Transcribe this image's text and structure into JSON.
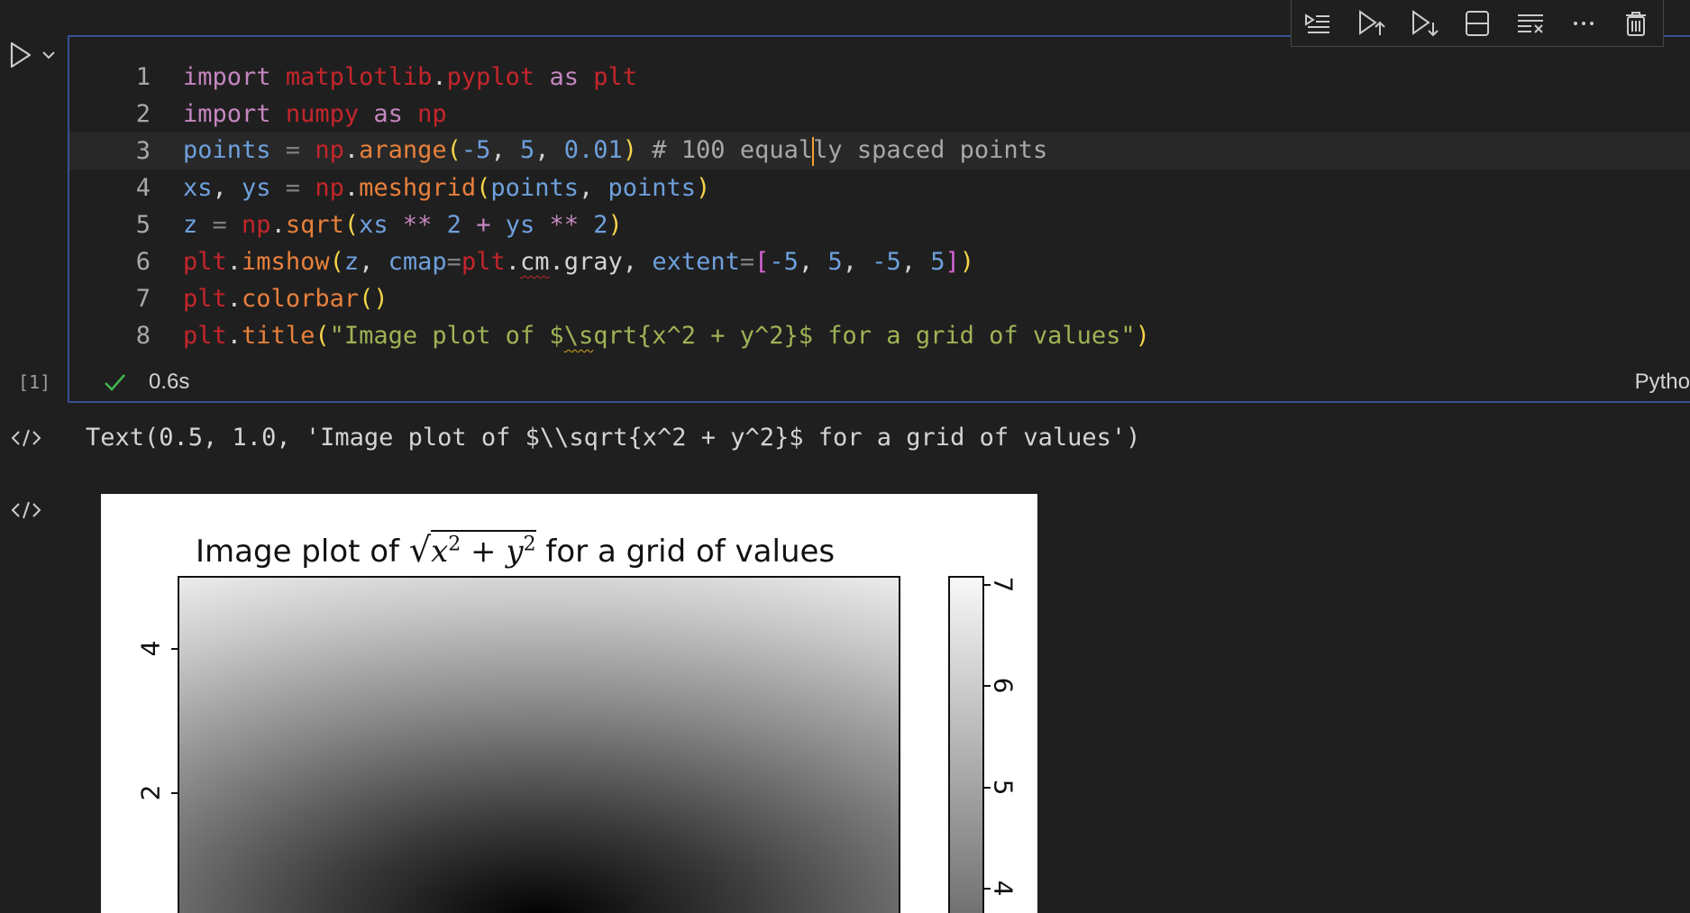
{
  "toolbar": {
    "buttons": [
      {
        "name": "run-by-line",
        "icon": "run-by-line-icon"
      },
      {
        "name": "execute-above",
        "icon": "execute-above-icon"
      },
      {
        "name": "execute-below",
        "icon": "execute-below-icon"
      },
      {
        "name": "split-cell",
        "icon": "split-cell-icon"
      },
      {
        "name": "clear-output",
        "icon": "clear-output-icon"
      },
      {
        "name": "more-actions",
        "icon": "ellipsis-icon"
      },
      {
        "name": "delete-cell",
        "icon": "trash-icon"
      }
    ]
  },
  "cell": {
    "execution_count": "[1]",
    "status_time": "0.6s",
    "language": "Pytho",
    "line_numbers": [
      "1",
      "2",
      "3",
      "4",
      "5",
      "6",
      "7",
      "8"
    ]
  },
  "code_tokens": {
    "l1": [
      "import",
      " ",
      "matplotlib",
      ".",
      "pyplot",
      " ",
      "as",
      " ",
      "plt"
    ],
    "l2": [
      "import",
      " ",
      "numpy",
      " ",
      "as",
      " ",
      "np"
    ],
    "l3": [
      "points",
      " = ",
      "np",
      ".",
      "arange",
      "(",
      "-5",
      ", ",
      "5",
      ", ",
      "0.01",
      ")",
      " # 100 equal",
      "ly spaced points"
    ],
    "l4": [
      "xs",
      ", ",
      "ys",
      " = ",
      "np",
      ".",
      "meshgrid",
      "(",
      "points",
      ", ",
      "points",
      ")"
    ],
    "l5": [
      "z",
      " = ",
      "np",
      ".",
      "sqrt",
      "(",
      "xs",
      " ** ",
      "2",
      " + ",
      "ys",
      " ** ",
      "2",
      ")"
    ],
    "l6": [
      "plt",
      ".",
      "imshow",
      "(",
      "z",
      ", ",
      "cmap",
      "=",
      "plt",
      ".",
      "cm",
      ".",
      "gray",
      ", ",
      "extent",
      "=",
      "[",
      "-5",
      ", ",
      "5",
      ", ",
      "-5",
      ", ",
      "5",
      "]",
      ")"
    ],
    "l7": [
      "plt",
      ".",
      "colorbar",
      "()"
    ],
    "l8": [
      "plt",
      ".",
      "title",
      "(",
      "\"Image plot of $",
      "\\s",
      "qrt{x^2 + y^2}$ for a grid of values\"",
      ")"
    ]
  },
  "outputs": {
    "text_output": "Text(0.5, 1.0, 'Image plot of $\\\\sqrt{x^2 + y^2}$ for a grid of values')"
  },
  "plot": {
    "title_prefix": "Image plot of ",
    "title_math_x": "x",
    "title_math_sup1": "2",
    "title_math_plus": " + ",
    "title_math_y": "y",
    "title_math_sup2": "2",
    "title_suffix": " for a grid of values",
    "y_ticks": [
      "4",
      "2"
    ],
    "colorbar_ticks": [
      "7",
      "6",
      "5",
      "4"
    ]
  },
  "colors": {
    "accent_border": "#3a4f94",
    "success_check": "#3fb950"
  }
}
